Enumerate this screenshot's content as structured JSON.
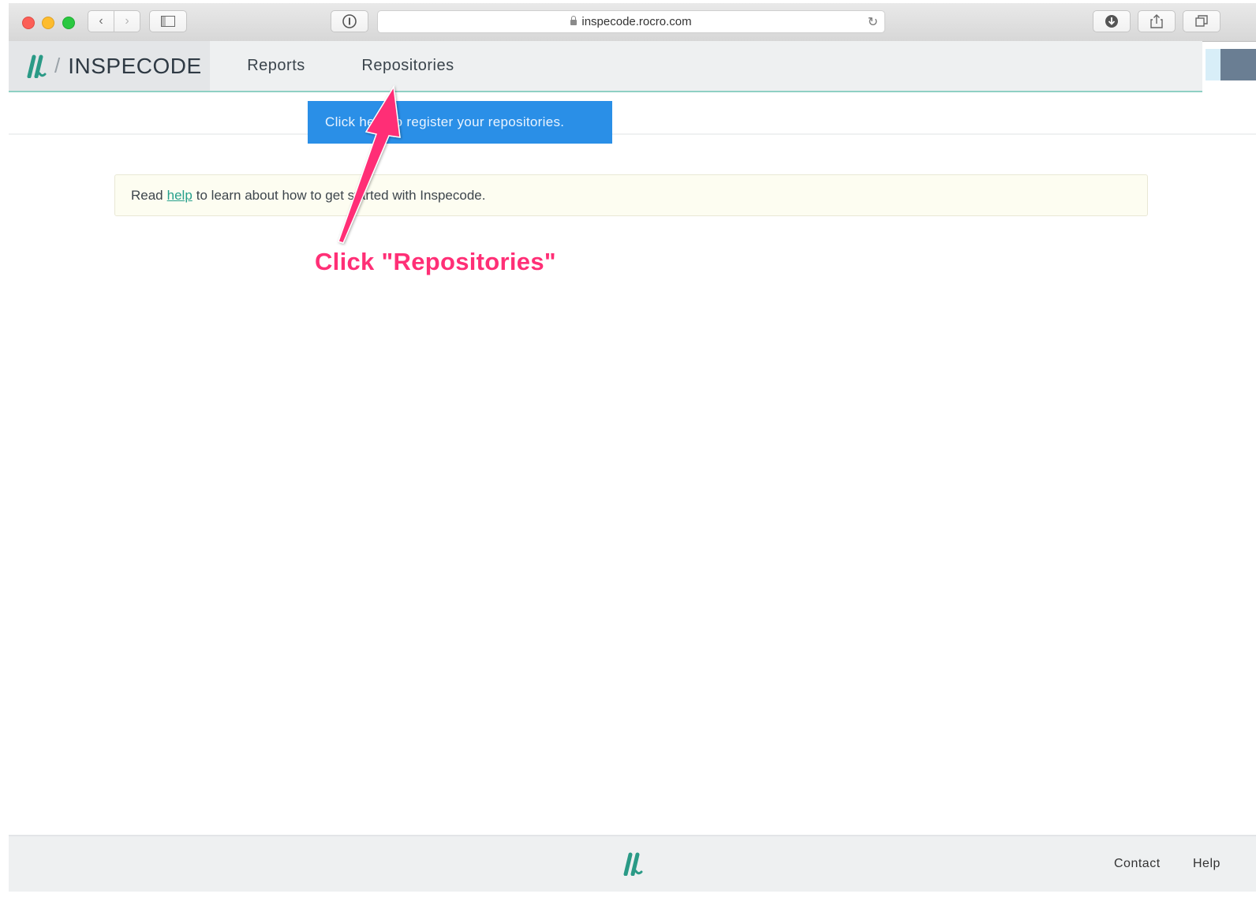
{
  "browser": {
    "url": "inspecode.rocro.com"
  },
  "app": {
    "brand_name": "INSPECODE",
    "brand_separator": "/",
    "nav": {
      "reports": "Reports",
      "repositories": "Repositories"
    },
    "colors": {
      "accent": "#2a9a86",
      "tooltip_bg": "#2a8fe7",
      "annotation": "#ff2f76"
    }
  },
  "tooltip": {
    "text": "Click here to register your repositories."
  },
  "notice": {
    "prefix": "Read",
    "link": "help",
    "suffix": "to learn about how to get started with Inspecode."
  },
  "annotation": {
    "text": "Click \"Repositories\""
  },
  "footer": {
    "contact": "Contact",
    "help": "Help"
  }
}
